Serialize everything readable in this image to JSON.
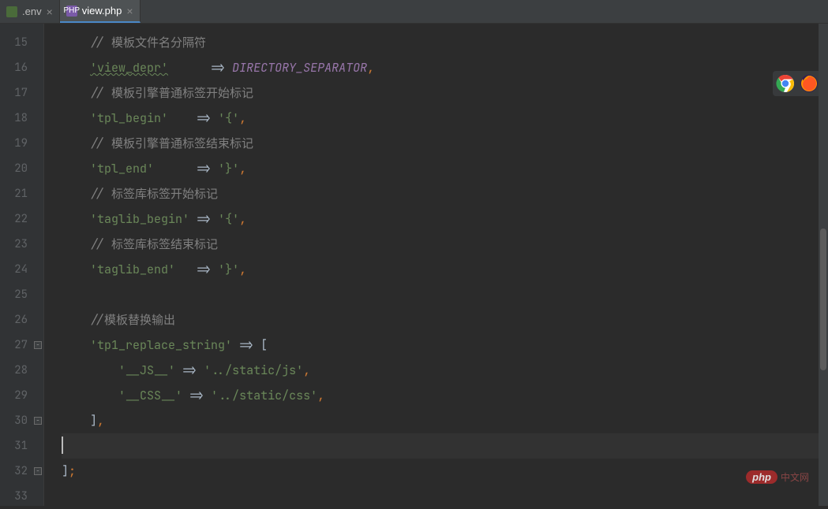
{
  "tabs": [
    {
      "label": ".env",
      "active": false,
      "icon_bg": "#4a6b3a",
      "icon_text": ""
    },
    {
      "label": "view.php",
      "active": true,
      "icon_bg": "#7a5aa8",
      "icon_text": "PHP"
    }
  ],
  "close_glyph": "×",
  "line_start": 15,
  "lines": [
    {
      "type": "comment",
      "slashes": "// ",
      "text": "模板文件名分隔符"
    },
    {
      "type": "kv_const",
      "key": "'view_depr'",
      "spaces": "      ",
      "const": "DIRECTORY_SEPARATOR",
      "trail": ",",
      "wavy": true
    },
    {
      "type": "comment",
      "slashes": "// ",
      "text": "模板引擎普通标签开始标记"
    },
    {
      "type": "kv_str",
      "key": "'tpl_begin'",
      "spaces": "    ",
      "val": "'{'",
      "trail": ","
    },
    {
      "type": "comment",
      "slashes": "// ",
      "text": "模板引擎普通标签结束标记"
    },
    {
      "type": "kv_str",
      "key": "'tpl_end'",
      "spaces": "      ",
      "val": "'}'",
      "trail": ","
    },
    {
      "type": "comment",
      "slashes": "// ",
      "text": "标签库标签开始标记"
    },
    {
      "type": "kv_str",
      "key": "'taglib_begin'",
      "spaces": " ",
      "val": "'{'",
      "trail": ","
    },
    {
      "type": "comment",
      "slashes": "// ",
      "text": "标签库标签结束标记"
    },
    {
      "type": "kv_str",
      "key": "'taglib_end'",
      "spaces": "   ",
      "val": "'}'",
      "trail": ","
    },
    {
      "type": "blank"
    },
    {
      "type": "comment",
      "slashes": "//",
      "text": "模板替换输出"
    },
    {
      "type": "arr_open",
      "key": "'tp1_replace_string'",
      "spaces": " ",
      "bracket": "["
    },
    {
      "type": "kv_str_indent",
      "key": "'__JS__'",
      "spaces": " ",
      "val": "'../static/js'",
      "trail": ","
    },
    {
      "type": "kv_str_indent",
      "key": "'__CSS__'",
      "spaces": " ",
      "val": "'../static/css'",
      "trail": ","
    },
    {
      "type": "arr_close",
      "bracket": "]",
      "trail": ","
    },
    {
      "type": "current_blank"
    },
    {
      "type": "end",
      "bracket": "]",
      "semi": ";"
    },
    {
      "type": "blank_noindent"
    }
  ],
  "arrow": "=>",
  "indent1": "    ",
  "indent2": "        ",
  "fold_marks": [
    {
      "line": 27,
      "glyph": "−"
    },
    {
      "line": 30,
      "glyph": "−"
    },
    {
      "line": 32,
      "glyph": "−"
    }
  ],
  "float_icons": {
    "chrome": "chrome-icon",
    "firefox": "firefox-icon"
  },
  "watermark": {
    "badge": "php",
    "text": "中文网"
  }
}
